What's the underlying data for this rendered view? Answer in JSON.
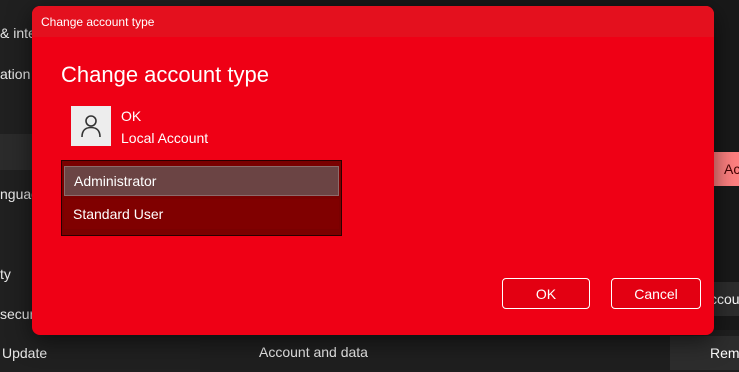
{
  "background": {
    "sidebar_items": [
      "& inte",
      "ation",
      "nguag",
      "ty",
      "secur",
      "Update"
    ],
    "main": {
      "account_and_data_label": "Account and data",
      "right_button_top": "Ac",
      "right_button_mid": "ccou",
      "right_button_bottom": "Rem"
    }
  },
  "dialog": {
    "window_title": "Change account type",
    "heading": "Change account type",
    "account": {
      "name": "OK",
      "type": "Local Account",
      "avatar_icon": "person-icon"
    },
    "options": [
      "Administrator",
      "Standard User"
    ],
    "selected_option": "Administrator",
    "ok_label": "OK",
    "cancel_label": "Cancel"
  },
  "colors": {
    "dialog_bg": "#ef0015",
    "listbox_bg": "#7a0000",
    "selected_bg": "#6b4444"
  }
}
